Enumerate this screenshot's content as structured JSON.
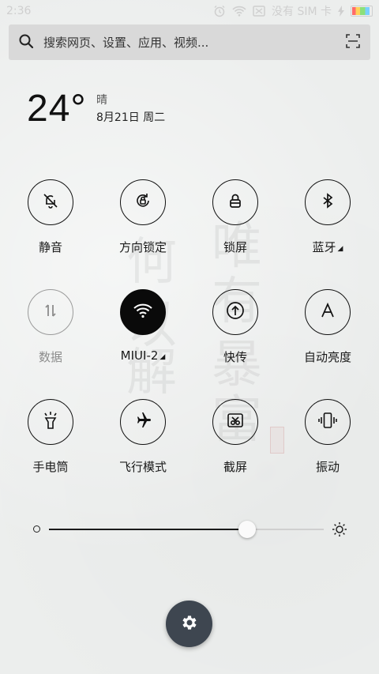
{
  "status_bar": {
    "time": "2:36",
    "carrier": "没有 SIM 卡",
    "icons": [
      "alarm-icon",
      "wifi-icon",
      "no-sim-icon",
      "charging-icon",
      "battery-icon"
    ],
    "battery_level": 0.92
  },
  "search": {
    "placeholder": "搜索网页、设置、应用、视频...",
    "icon": "search-icon",
    "scan_icon": "scan-icon"
  },
  "weather": {
    "temperature": "24°",
    "condition": "晴",
    "date": "8月21日 周二"
  },
  "toggles": [
    {
      "id": "mute",
      "label": "静音",
      "icon": "bell-off-icon",
      "state": "off"
    },
    {
      "id": "rotation",
      "label": "方向锁定",
      "icon": "rotation-lock-icon",
      "state": "off"
    },
    {
      "id": "lock",
      "label": "锁屏",
      "icon": "lock-icon",
      "state": "off"
    },
    {
      "id": "bluetooth",
      "label": "蓝牙",
      "icon": "bluetooth-icon",
      "state": "off",
      "has_more": true
    },
    {
      "id": "data",
      "label": "数据",
      "icon": "mobile-data-icon",
      "state": "disabled"
    },
    {
      "id": "wifi",
      "label": "MIUI-2",
      "icon": "wifi-icon",
      "state": "on",
      "has_more": true
    },
    {
      "id": "quickshare",
      "label": "快传",
      "icon": "upload-icon",
      "state": "off"
    },
    {
      "id": "auto_brightness",
      "label": "自动亮度",
      "icon": "letter-a-icon",
      "state": "off"
    },
    {
      "id": "flashlight",
      "label": "手电筒",
      "icon": "flashlight-icon",
      "state": "off"
    },
    {
      "id": "airplane",
      "label": "飞行模式",
      "icon": "airplane-icon",
      "state": "off"
    },
    {
      "id": "screenshot",
      "label": "截屏",
      "icon": "scissors-icon",
      "state": "off"
    },
    {
      "id": "vibrate",
      "label": "振动",
      "icon": "vibrate-icon",
      "state": "off"
    }
  ],
  "brightness": {
    "level": 0.72,
    "low_icon": "brightness-low-icon",
    "high_icon": "sun-icon"
  },
  "settings_button": {
    "icon": "gear-icon"
  },
  "colors": {
    "background": "#eceeed",
    "search_bg": "#d9d9d9",
    "toggle_on": "#0a0a0a",
    "fab": "#3e4650"
  }
}
